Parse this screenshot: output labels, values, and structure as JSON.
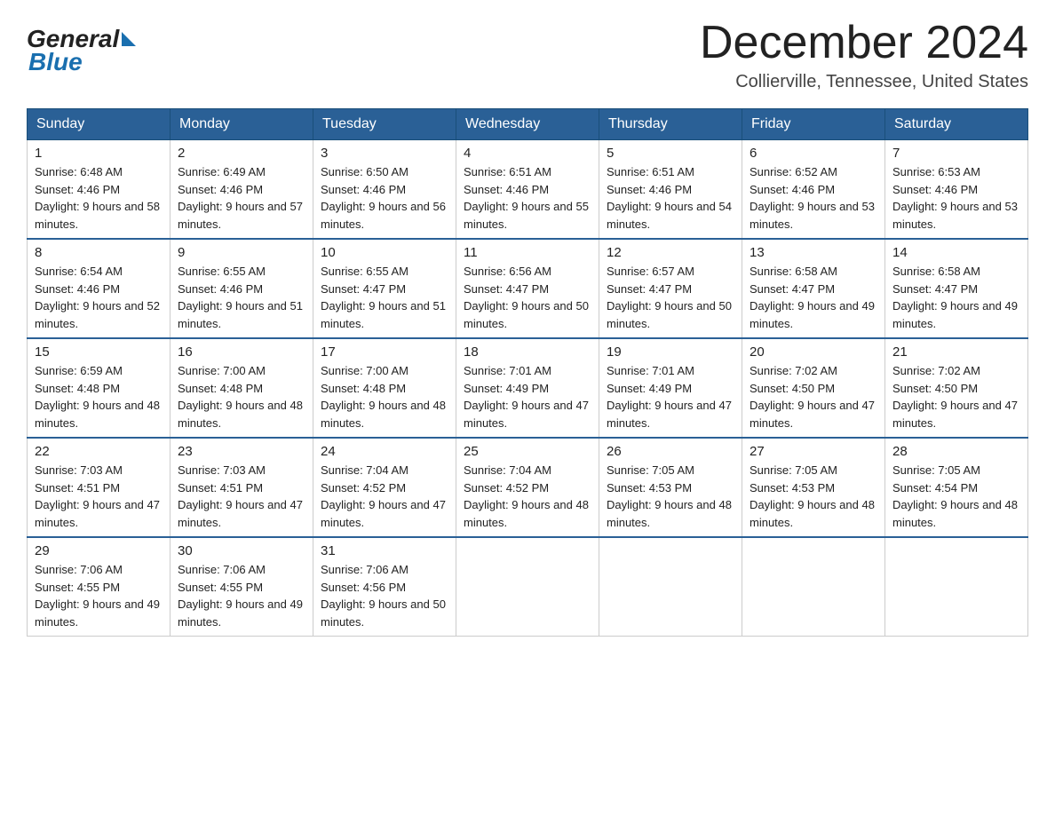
{
  "logo": {
    "general": "General",
    "blue": "Blue"
  },
  "header": {
    "month": "December 2024",
    "location": "Collierville, Tennessee, United States"
  },
  "weekdays": [
    "Sunday",
    "Monday",
    "Tuesday",
    "Wednesday",
    "Thursday",
    "Friday",
    "Saturday"
  ],
  "weeks": [
    [
      {
        "day": "1",
        "sunrise": "6:48 AM",
        "sunset": "4:46 PM",
        "daylight": "9 hours and 58 minutes."
      },
      {
        "day": "2",
        "sunrise": "6:49 AM",
        "sunset": "4:46 PM",
        "daylight": "9 hours and 57 minutes."
      },
      {
        "day": "3",
        "sunrise": "6:50 AM",
        "sunset": "4:46 PM",
        "daylight": "9 hours and 56 minutes."
      },
      {
        "day": "4",
        "sunrise": "6:51 AM",
        "sunset": "4:46 PM",
        "daylight": "9 hours and 55 minutes."
      },
      {
        "day": "5",
        "sunrise": "6:51 AM",
        "sunset": "4:46 PM",
        "daylight": "9 hours and 54 minutes."
      },
      {
        "day": "6",
        "sunrise": "6:52 AM",
        "sunset": "4:46 PM",
        "daylight": "9 hours and 53 minutes."
      },
      {
        "day": "7",
        "sunrise": "6:53 AM",
        "sunset": "4:46 PM",
        "daylight": "9 hours and 53 minutes."
      }
    ],
    [
      {
        "day": "8",
        "sunrise": "6:54 AM",
        "sunset": "4:46 PM",
        "daylight": "9 hours and 52 minutes."
      },
      {
        "day": "9",
        "sunrise": "6:55 AM",
        "sunset": "4:46 PM",
        "daylight": "9 hours and 51 minutes."
      },
      {
        "day": "10",
        "sunrise": "6:55 AM",
        "sunset": "4:47 PM",
        "daylight": "9 hours and 51 minutes."
      },
      {
        "day": "11",
        "sunrise": "6:56 AM",
        "sunset": "4:47 PM",
        "daylight": "9 hours and 50 minutes."
      },
      {
        "day": "12",
        "sunrise": "6:57 AM",
        "sunset": "4:47 PM",
        "daylight": "9 hours and 50 minutes."
      },
      {
        "day": "13",
        "sunrise": "6:58 AM",
        "sunset": "4:47 PM",
        "daylight": "9 hours and 49 minutes."
      },
      {
        "day": "14",
        "sunrise": "6:58 AM",
        "sunset": "4:47 PM",
        "daylight": "9 hours and 49 minutes."
      }
    ],
    [
      {
        "day": "15",
        "sunrise": "6:59 AM",
        "sunset": "4:48 PM",
        "daylight": "9 hours and 48 minutes."
      },
      {
        "day": "16",
        "sunrise": "7:00 AM",
        "sunset": "4:48 PM",
        "daylight": "9 hours and 48 minutes."
      },
      {
        "day": "17",
        "sunrise": "7:00 AM",
        "sunset": "4:48 PM",
        "daylight": "9 hours and 48 minutes."
      },
      {
        "day": "18",
        "sunrise": "7:01 AM",
        "sunset": "4:49 PM",
        "daylight": "9 hours and 47 minutes."
      },
      {
        "day": "19",
        "sunrise": "7:01 AM",
        "sunset": "4:49 PM",
        "daylight": "9 hours and 47 minutes."
      },
      {
        "day": "20",
        "sunrise": "7:02 AM",
        "sunset": "4:50 PM",
        "daylight": "9 hours and 47 minutes."
      },
      {
        "day": "21",
        "sunrise": "7:02 AM",
        "sunset": "4:50 PM",
        "daylight": "9 hours and 47 minutes."
      }
    ],
    [
      {
        "day": "22",
        "sunrise": "7:03 AM",
        "sunset": "4:51 PM",
        "daylight": "9 hours and 47 minutes."
      },
      {
        "day": "23",
        "sunrise": "7:03 AM",
        "sunset": "4:51 PM",
        "daylight": "9 hours and 47 minutes."
      },
      {
        "day": "24",
        "sunrise": "7:04 AM",
        "sunset": "4:52 PM",
        "daylight": "9 hours and 47 minutes."
      },
      {
        "day": "25",
        "sunrise": "7:04 AM",
        "sunset": "4:52 PM",
        "daylight": "9 hours and 48 minutes."
      },
      {
        "day": "26",
        "sunrise": "7:05 AM",
        "sunset": "4:53 PM",
        "daylight": "9 hours and 48 minutes."
      },
      {
        "day": "27",
        "sunrise": "7:05 AM",
        "sunset": "4:53 PM",
        "daylight": "9 hours and 48 minutes."
      },
      {
        "day": "28",
        "sunrise": "7:05 AM",
        "sunset": "4:54 PM",
        "daylight": "9 hours and 48 minutes."
      }
    ],
    [
      {
        "day": "29",
        "sunrise": "7:06 AM",
        "sunset": "4:55 PM",
        "daylight": "9 hours and 49 minutes."
      },
      {
        "day": "30",
        "sunrise": "7:06 AM",
        "sunset": "4:55 PM",
        "daylight": "9 hours and 49 minutes."
      },
      {
        "day": "31",
        "sunrise": "7:06 AM",
        "sunset": "4:56 PM",
        "daylight": "9 hours and 50 minutes."
      },
      null,
      null,
      null,
      null
    ]
  ],
  "labels": {
    "sunrise_prefix": "Sunrise: ",
    "sunset_prefix": "Sunset: ",
    "daylight_prefix": "Daylight: "
  }
}
